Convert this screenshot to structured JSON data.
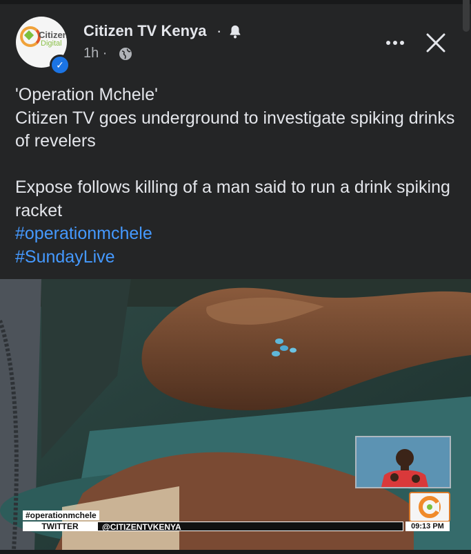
{
  "post": {
    "page_name": "Citizen TV Kenya",
    "separator": "·",
    "time": "1h ·",
    "avatar_text_1": "Citizen",
    "avatar_text_2": "Digital",
    "text_line1": "'Operation Mchele'",
    "text_line2": "Citizen TV goes underground to investigate spiking drinks of revelers",
    "text_line3": "Expose follows killing of a man said to run a drink spiking racket",
    "hashtags": [
      "#operationmchele",
      "#SundayLive"
    ]
  },
  "media": {
    "ticker_tag": "#operationmchele",
    "ticker_left": "TWITTER",
    "ticker_handle": "@CITIZENTVKENYA",
    "ticker_time": "09:13 PM"
  },
  "icons": {
    "verified": "verified-badge-icon",
    "bell": "bell-icon",
    "globe": "globe-icon",
    "more": "more-options-icon",
    "close": "close-icon"
  },
  "colors": {
    "background": "#242526",
    "text": "#e4e6eb",
    "secondary_text": "#b0b3b8",
    "link": "#4599ff",
    "verified": "#1b74e4"
  }
}
